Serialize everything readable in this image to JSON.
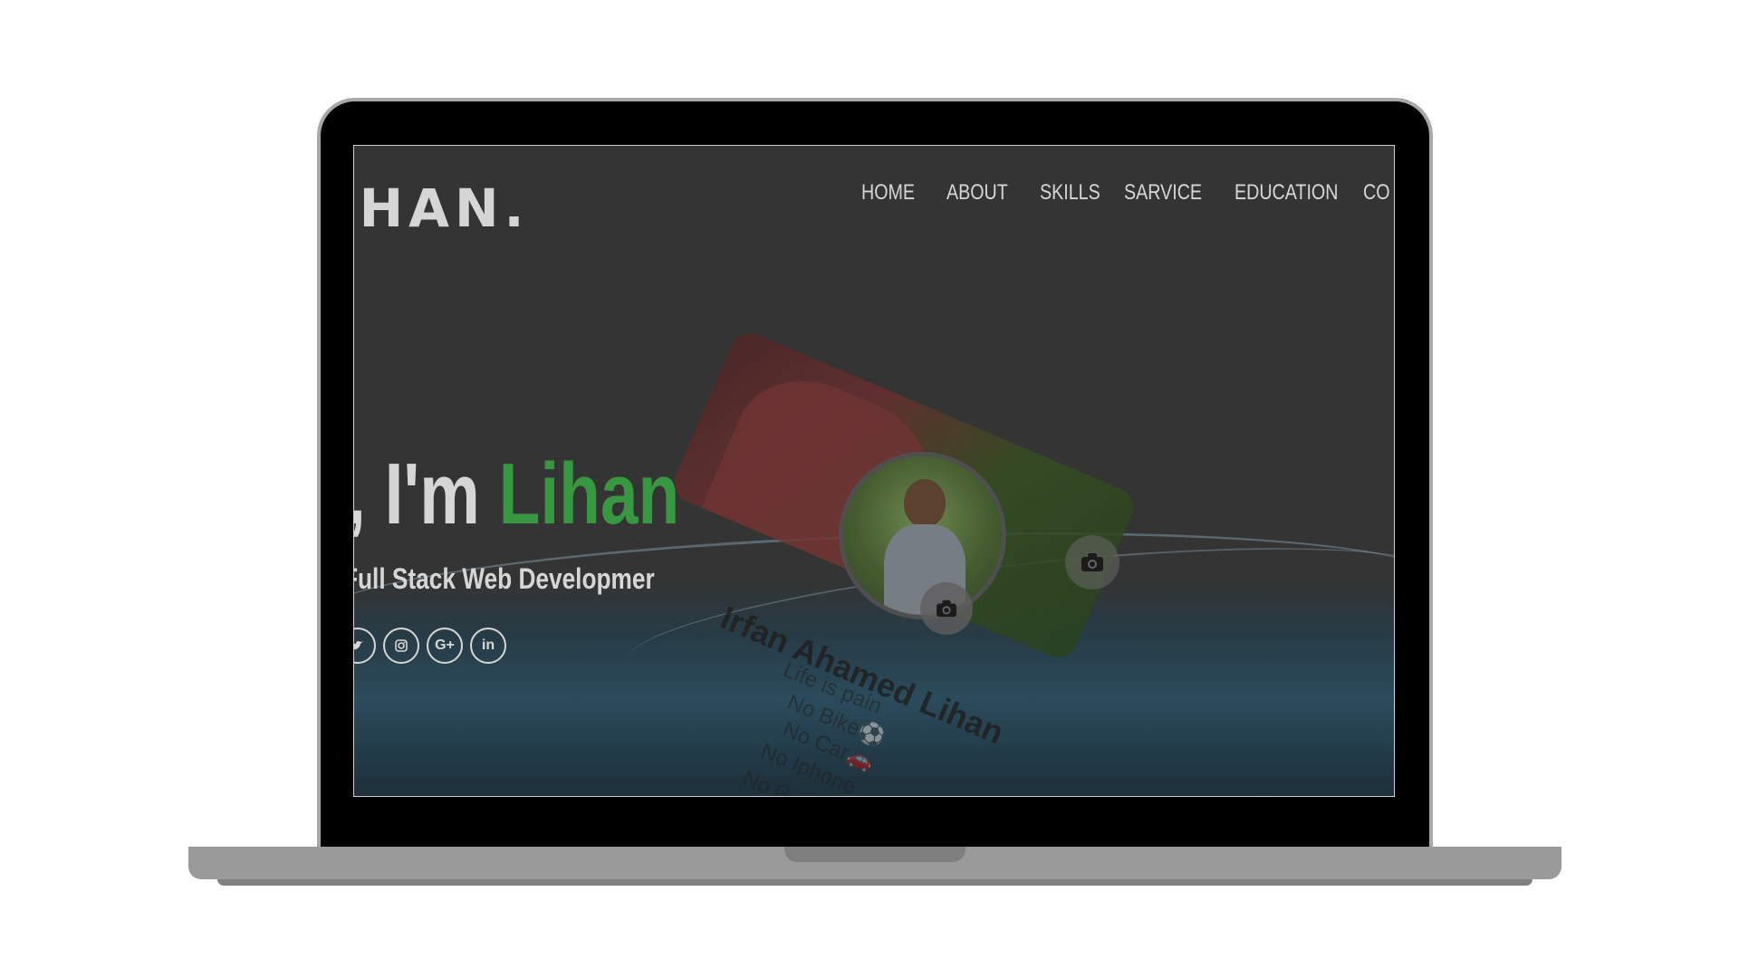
{
  "site": {
    "logo": "IHAN.",
    "nav": [
      "HOME",
      "ABOUT",
      "SKILLS",
      "SARVICE",
      "EDUCATION",
      "CO"
    ],
    "hero": {
      "greeting": ", I'm ",
      "name": "Lihan",
      "subtitle": "Full Stack Web Developmer"
    },
    "social_icons": [
      "twitter-icon",
      "instagram-icon",
      "google-plus-icon",
      "linkedin-icon"
    ],
    "social_labels": {
      "google_plus": "G+",
      "linkedin": "in"
    },
    "profile": {
      "name": "Irfan Ahamed Lihan",
      "bio_lines": [
        "Life is pain",
        "No Bike⚽",
        "No Car🚗",
        "No Iphone",
        "No G"
      ]
    },
    "colors": {
      "accent": "#3fb24a",
      "screen_bg": "#3a3a3a",
      "text": "#ffffff"
    }
  }
}
